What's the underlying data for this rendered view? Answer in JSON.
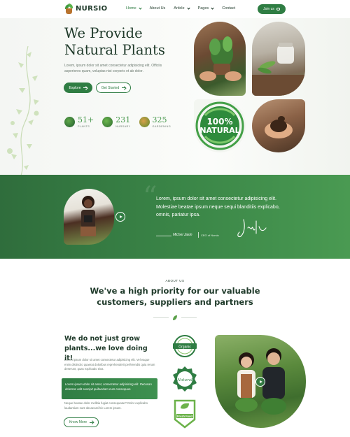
{
  "brand": {
    "name": "NURSIO"
  },
  "nav": {
    "items": [
      {
        "label": "Home",
        "dropdown": true,
        "active": true
      },
      {
        "label": "About Us",
        "dropdown": false,
        "active": false
      },
      {
        "label": "Article",
        "dropdown": true,
        "active": false
      },
      {
        "label": "Pages",
        "dropdown": true,
        "active": false
      },
      {
        "label": "Contact",
        "dropdown": false,
        "active": false
      }
    ],
    "join_label": "Join us"
  },
  "hero": {
    "title_line1": "We Provide",
    "title_line2": "Natural Plants",
    "subtitle": "Lorem, ipsum dolor sit amet consectetur adipisicing elit. Officiis asperiores quam, voluptas nisi corporis et ab dolor.",
    "explore_label": "Explore",
    "start_label": "Get Started",
    "stats": [
      {
        "value": "51+",
        "label": "PLANTS"
      },
      {
        "value": "231",
        "label": "NURSARY"
      },
      {
        "value": "325",
        "label": "GARDENING"
      }
    ],
    "badge": {
      "percent": "100%",
      "word": "NATURAL"
    }
  },
  "testimonial": {
    "text": "Lorem, ipsum dolor sit amet consectetur adipisicing elit. Molestiae beatae ipsum neque sequi blanditiis explicabo, omnis, pariatur ipsa.",
    "name": "Michel Jasin",
    "role": "CEO of Nursio"
  },
  "about": {
    "tag": "ABOUT US",
    "title_line1": "We've a high priority for our valuable",
    "title_line2": "customers, suppliers and partners",
    "heading_line1": "We do not just grow",
    "heading_line2": "plants...we love doing it!",
    "para1": "Lorem ipsum dolor sit amet consectetur adipisicing elit. Vel eaque enim distinctio quaerat doloribus reprehenderit perferendis quia rerum deserunt, quas explicabo eius.",
    "highlight": "Lorem ipsum dolor sit amet, consectetur adipisicing elit. Recusan delectus odit suscipit quibusdam cum consequun.",
    "para2": "Neque beatae dolor mollitia fugiat consequatur? Dolor explicabo laudantium sunt obcaecati hic Lorem ipsum.",
    "more_label": "Know More",
    "badges": [
      {
        "name": "organic",
        "text": "Organic"
      },
      {
        "name": "natural",
        "text": "Natural"
      },
      {
        "name": "fresh-food",
        "text": "Fresh Food"
      }
    ]
  },
  "colors": {
    "primary": "#2f7d43",
    "dark": "#1f3a2a",
    "accent": "#4a9a4f"
  }
}
